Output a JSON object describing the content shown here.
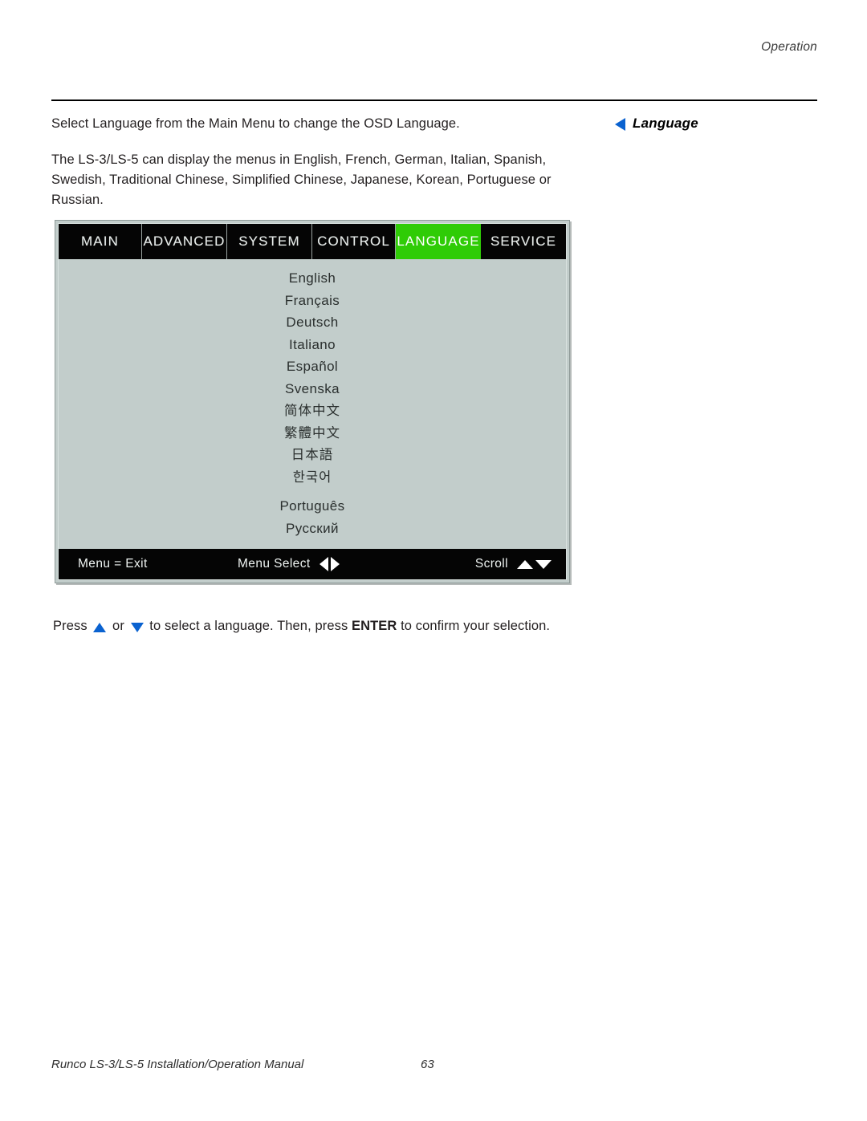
{
  "page": {
    "running_head": "Operation",
    "paragraphs": [
      "Select Language from the Main Menu to change the OSD Language.",
      "The LS-3/LS-5 can display the menus in English, French, German, Italian, Spanish, Swedish, Traditional Chinese, Simplified Chinese, Japanese, Korean, Portuguese or Russian."
    ]
  },
  "margin_note": {
    "label": "Language",
    "arrow_color": "#0a62d0"
  },
  "osd": {
    "tabs": [
      {
        "label": "MAIN",
        "active": false
      },
      {
        "label": "ADVANCED",
        "active": false
      },
      {
        "label": "SYSTEM",
        "active": false
      },
      {
        "label": "CONTROL",
        "active": false
      },
      {
        "label": "LANGUAGE",
        "active": true
      },
      {
        "label": "SERVICE",
        "active": false
      }
    ],
    "active_tab": "LANGUAGE",
    "highlight_color": "#2fcc06",
    "background_color": "#c2cdcb",
    "bar_color": "#050505",
    "languages": [
      "English",
      "Français",
      "Deutsch",
      "Italiano",
      "Español",
      "Svenska",
      "简体中文",
      "繁體中文",
      "日本語",
      "한국어",
      "Português",
      "Русский"
    ],
    "status_bar": {
      "exit": "Menu = Exit",
      "select": "Menu Select",
      "scroll": "Scroll"
    }
  },
  "instruction": {
    "prefix": "Press ",
    "between": " or ",
    "middle": " to select a language. Then, press ",
    "bold": "ENTER",
    "suffix": " to confirm your selection."
  },
  "footer": {
    "title": "Runco LS-3/LS-5 Installation/Operation Manual",
    "page_number": "63"
  }
}
